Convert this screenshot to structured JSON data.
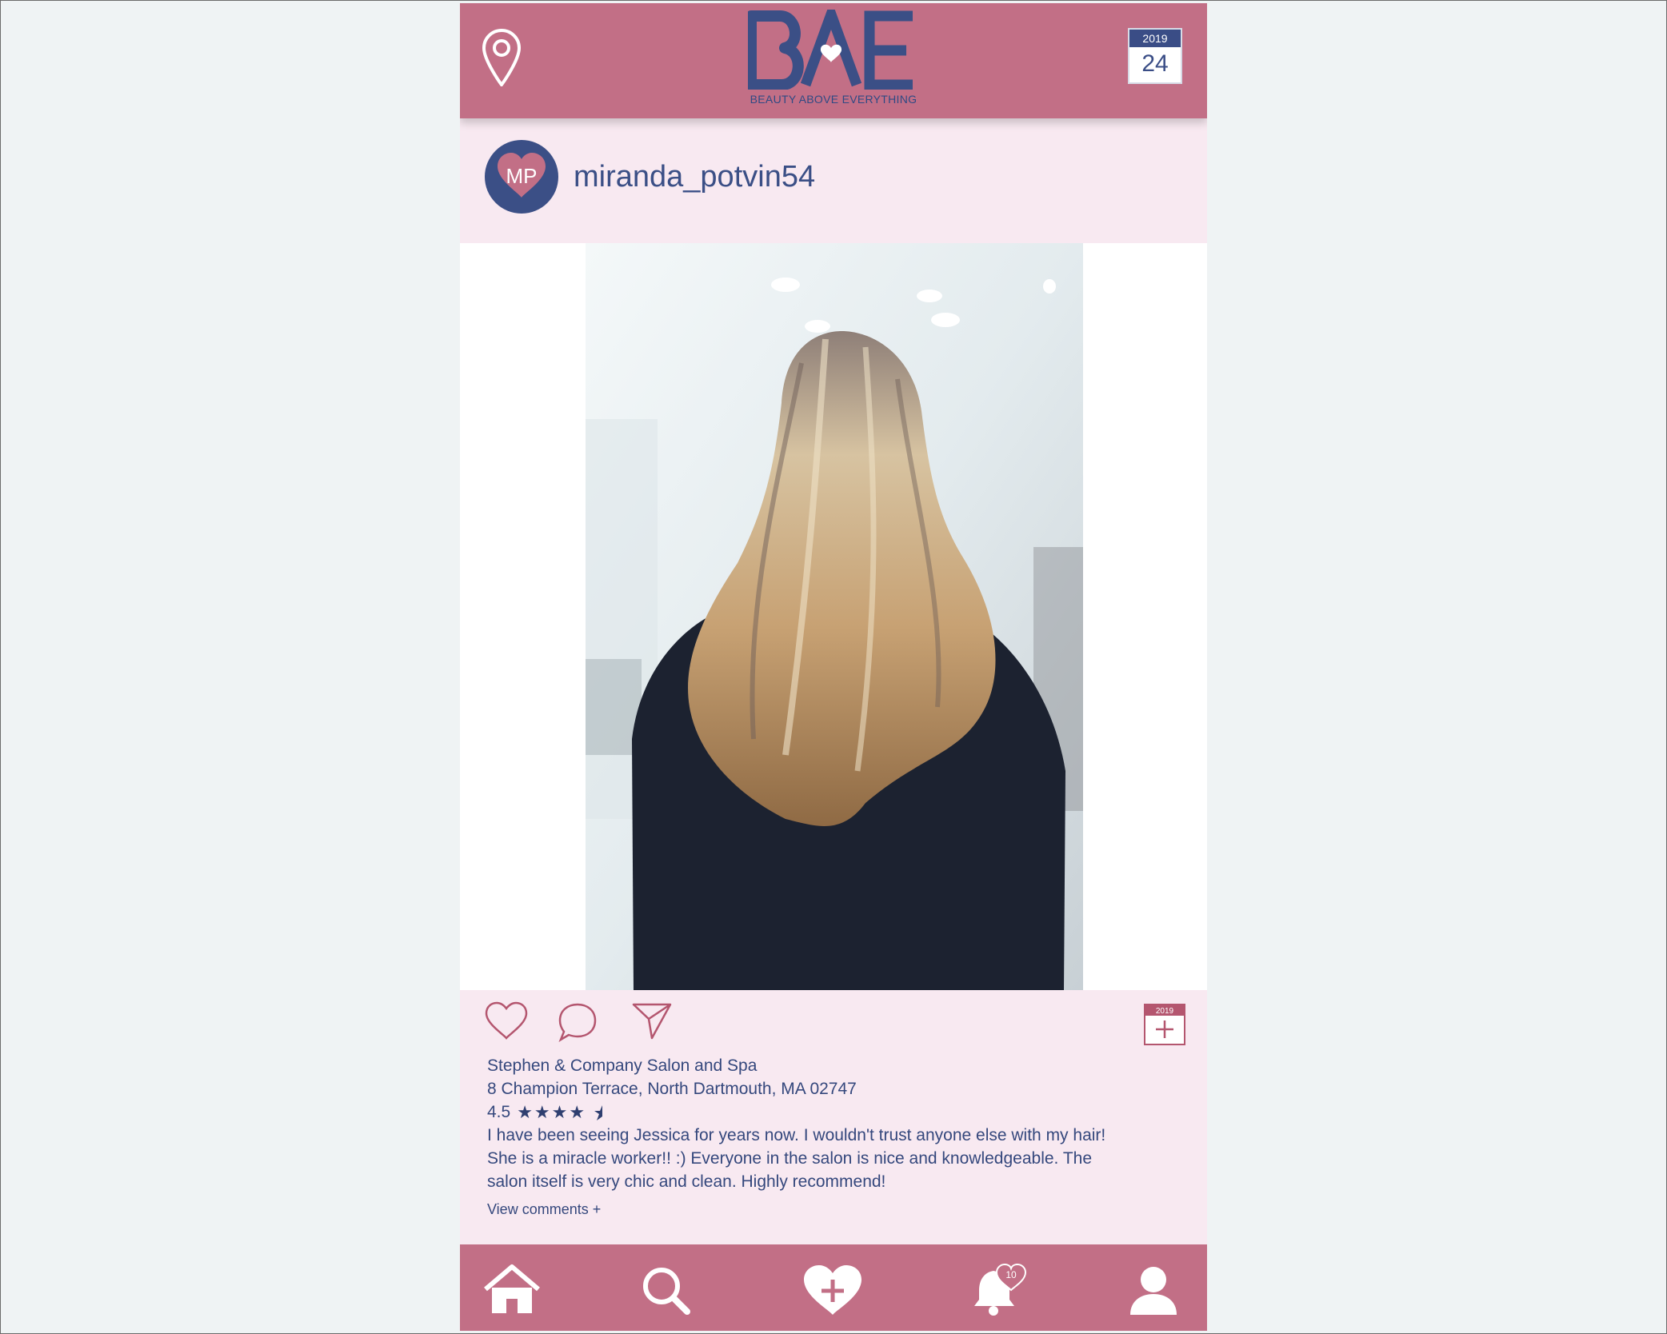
{
  "header": {
    "logo_text": "BAE",
    "tagline": "BEAUTY ABOVE EVERYTHING",
    "calendar_year": "2019",
    "calendar_day": "24",
    "brand_color": "#c26f86",
    "accent_color": "#3b4f86"
  },
  "post": {
    "avatar_initials": "MP",
    "username": "miranda_potvin54",
    "photo_description_icon": "photo",
    "actions": {
      "like_icon": "heart-outline-icon",
      "comment_icon": "speech-bubble-icon",
      "share_icon": "paper-plane-icon",
      "add_to_calendar_year": "2019"
    },
    "salon_name": "Stephen & Company Salon and Spa",
    "address": "8 Champion Terrace, North Dartmouth, MA 02747",
    "rating": "4.5",
    "stars_glyphs": "★★★★",
    "review_lines": [
      "I have been seeing Jessica for years now.  I wouldn't trust anyone else with my hair!",
      "She is a miracle worker!!  :)  Everyone in the salon is nice and knowledgeable.  The",
      "salon itself is very chic and clean.  Highly recommend!"
    ],
    "view_comments": "View comments +"
  },
  "nav": {
    "items": [
      "home-icon",
      "search-icon",
      "add-heart-icon",
      "notifications-icon",
      "profile-icon"
    ],
    "notification_count": "10"
  }
}
